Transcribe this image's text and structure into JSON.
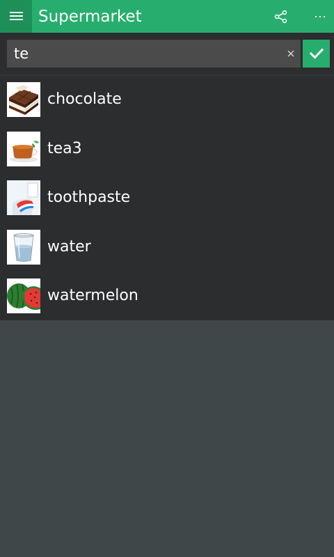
{
  "header": {
    "title": "Supermarket",
    "menu_icon": "hamburger-menu-icon",
    "share_icon": "share-icon",
    "more_icon": "more-options-icon",
    "background_color": "#27ae6e"
  },
  "search": {
    "value": "te",
    "clear_icon": "close-icon",
    "confirm_icon": "checkmark-icon"
  },
  "results": [
    {
      "label": "chocolate",
      "image": "chocolate-image"
    },
    {
      "label": "tea3",
      "image": "tea-cup-image"
    },
    {
      "label": "toothpaste",
      "image": "toothpaste-image"
    },
    {
      "label": "water",
      "image": "water-glass-image"
    },
    {
      "label": "watermelon",
      "image": "watermelon-image"
    }
  ]
}
